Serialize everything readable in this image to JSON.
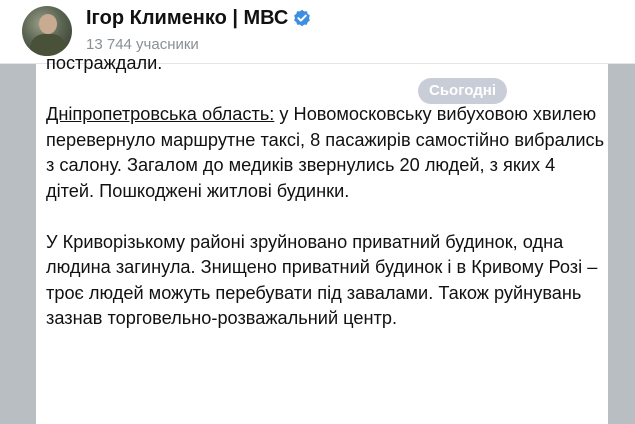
{
  "header": {
    "title": "Ігор Клименко | МВС",
    "subscribers": "13 744 учасники",
    "verified_icon": "verified-badge-icon",
    "verified_color": "#3d8fe0"
  },
  "date_badge": "Сьогодні",
  "message": {
    "line_top_cut": "постраждали.",
    "p1_link": "Дніпропетровська область:",
    "p1_text": " у Новомосковську вибуховою хвилею перевернуло маршрутне таксі, 8 пасажирів самостійно вибрались з салону. Загалом до медиків звернулись 20 людей, з яких 4 дітей. Пошкоджені житлові будинки.",
    "p2_text": "У Криворізькому районі зруйновано приватний будинок, одна людина загинула. Знищено приватний будинок і в Кривому Розі – троє людей можуть перебувати під завалами.  Також руйнувань зазнав торговельно-розважальний центр."
  },
  "colors": {
    "background": "#b9bec3",
    "bubble": "#ffffff",
    "badge": "rgba(154,164,184,0.55)"
  }
}
